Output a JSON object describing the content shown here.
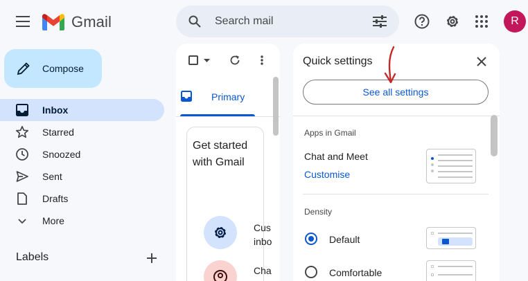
{
  "header": {
    "logo_text": "Gmail",
    "search_placeholder": "Search mail",
    "avatar_initial": "R",
    "icons": [
      "menu-icon",
      "search-icon",
      "filter-options-icon",
      "help-icon",
      "settings-icon",
      "apps-icon"
    ]
  },
  "sidebar": {
    "compose_label": "Compose",
    "items": [
      {
        "label": "Inbox",
        "icon": "inbox-icon",
        "active": true
      },
      {
        "label": "Starred",
        "icon": "star-icon"
      },
      {
        "label": "Snoozed",
        "icon": "clock-icon"
      },
      {
        "label": "Sent",
        "icon": "send-icon"
      },
      {
        "label": "Drafts",
        "icon": "draft-icon"
      },
      {
        "label": "More",
        "icon": "chevron-down-icon"
      }
    ],
    "labels_title": "Labels"
  },
  "mail": {
    "tab_primary": "Primary",
    "get_started_title": "Get started with Gmail",
    "items": [
      {
        "label": "Cus inbo",
        "icon": "gear-icon"
      },
      {
        "label": "Cha",
        "icon": "profile-icon"
      }
    ]
  },
  "quick_settings": {
    "title": "Quick settings",
    "see_all": "See all settings",
    "apps_section": "Apps in Gmail",
    "chat_meet": "Chat and Meet",
    "customise": "Customise",
    "density_section": "Density",
    "density_options": [
      {
        "label": "Default",
        "selected": true
      },
      {
        "label": "Comfortable",
        "selected": false
      }
    ]
  },
  "colors": {
    "accent": "#0b57d0",
    "compose_bg": "#c2e7ff",
    "active_nav": "#d3e3fd",
    "annotation_arrow": "#c62828"
  }
}
